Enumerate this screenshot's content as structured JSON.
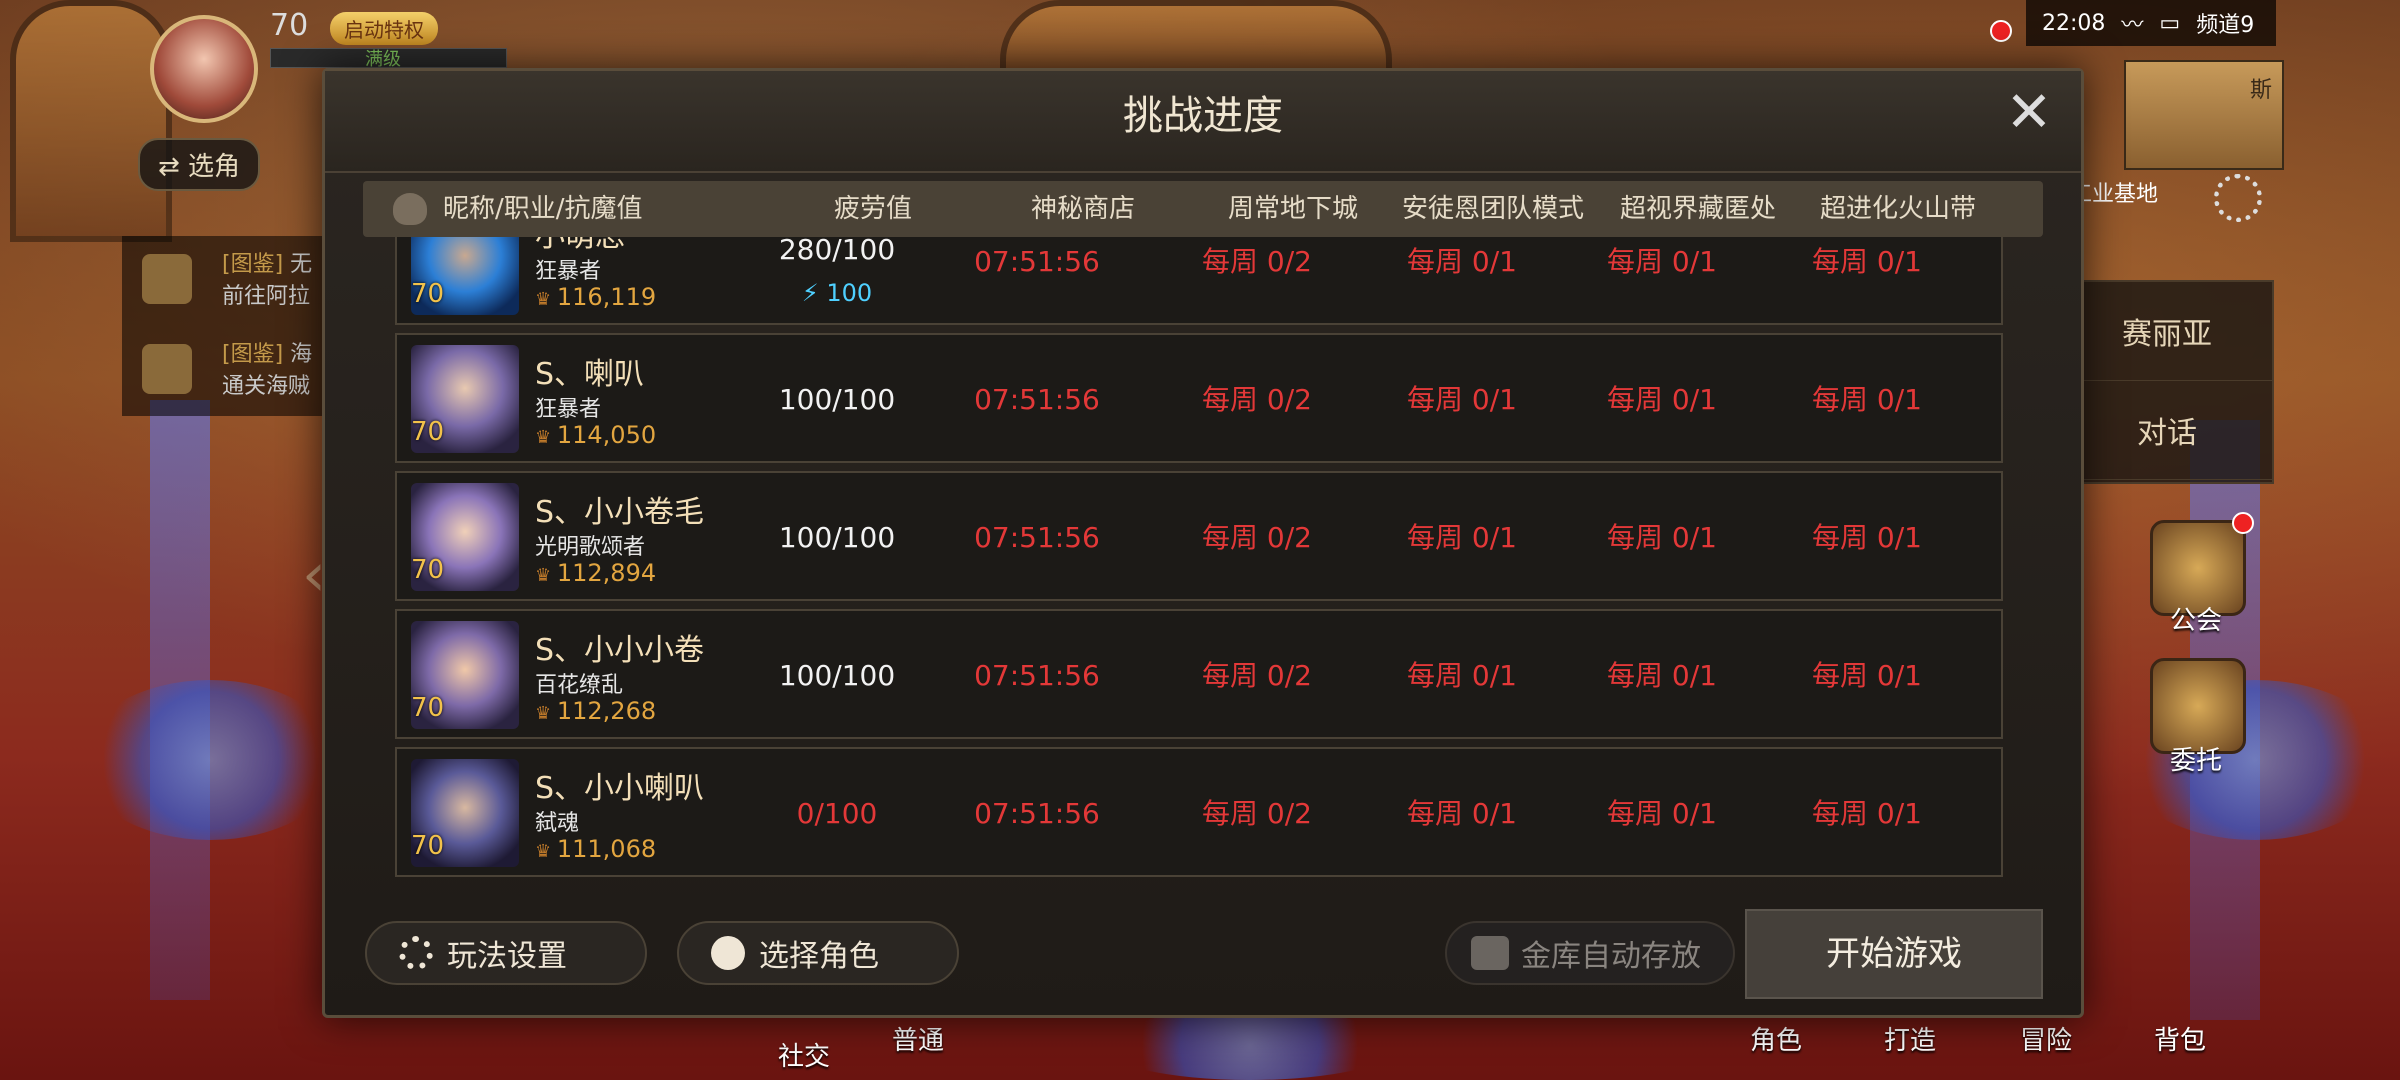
{
  "hud": {
    "level": "70",
    "privilege_badge": "启动特权",
    "full_level": "满级",
    "switch_role": "⇄ 选角",
    "quests": [
      {
        "tag": "[图鉴]",
        "title": "无",
        "desc": "前往阿拉"
      },
      {
        "tag": "[图鉴]",
        "title": "海",
        "desc": "通关海贼"
      }
    ]
  },
  "status": {
    "time": "22:08",
    "channel": "频道9",
    "minimap_label": "斯"
  },
  "area_label": "工业基地",
  "npc_panel": {
    "name": "赛丽亚",
    "dialog": "对话"
  },
  "side_menu": {
    "guild": "公会",
    "commission": "委托",
    "dialog_hidden": "对话"
  },
  "bottom_menu": {
    "social": "社交",
    "normal": "普通",
    "character": "角色",
    "craft": "打造",
    "adventure": "冒险",
    "bag": "背包"
  },
  "modal": {
    "title": "挑战进度",
    "close": "✕",
    "columns": [
      "昵称/职业/抗魔值",
      "疲劳值",
      "神秘商店",
      "周常地下城",
      "安徒恩团队模式",
      "超视界藏匿处",
      "超进化火山带"
    ],
    "rows": [
      {
        "level": "70",
        "name": "小萌总",
        "job": "狂暴者",
        "power": "116,119",
        "fatigue": "280/100",
        "fatigue_bonus": "⚡ 100",
        "shop": "07:51:56",
        "weekly_dungeon": "每周 0/2",
        "anton": "每周 0/1",
        "hideout": "每周 0/1",
        "volcano": "每周 0/1"
      },
      {
        "level": "70",
        "name": "S、喇叭",
        "job": "狂暴者",
        "power": "114,050",
        "fatigue": "100/100",
        "shop": "07:51:56",
        "weekly_dungeon": "每周 0/2",
        "anton": "每周 0/1",
        "hideout": "每周 0/1",
        "volcano": "每周 0/1"
      },
      {
        "level": "70",
        "name": "S、小小卷毛",
        "job": "光明歌颂者",
        "power": "112,894",
        "fatigue": "100/100",
        "shop": "07:51:56",
        "weekly_dungeon": "每周 0/2",
        "anton": "每周 0/1",
        "hideout": "每周 0/1",
        "volcano": "每周 0/1"
      },
      {
        "level": "70",
        "name": "S、小小小卷",
        "job": "百花缭乱",
        "power": "112,268",
        "fatigue": "100/100",
        "shop": "07:51:56",
        "weekly_dungeon": "每周 0/2",
        "anton": "每周 0/1",
        "hideout": "每周 0/1",
        "volcano": "每周 0/1"
      },
      {
        "level": "70",
        "name": "S、小小喇叭",
        "job": "弑魂",
        "power": "111,068",
        "fatigue": "0/100",
        "shop": "07:51:56",
        "weekly_dungeon": "每周 0/2",
        "anton": "每周 0/1",
        "hideout": "每周 0/1",
        "volcano": "每周 0/1"
      }
    ],
    "buttons": {
      "settings": "玩法设置",
      "select_role": "选择角色",
      "vault_auto": "金库自动存放",
      "start_game": "开始游戏"
    }
  },
  "colors": {
    "accent_red": "#e33838",
    "fatigue_bonus": "#4fd0ff",
    "gold": "#e3a640"
  }
}
